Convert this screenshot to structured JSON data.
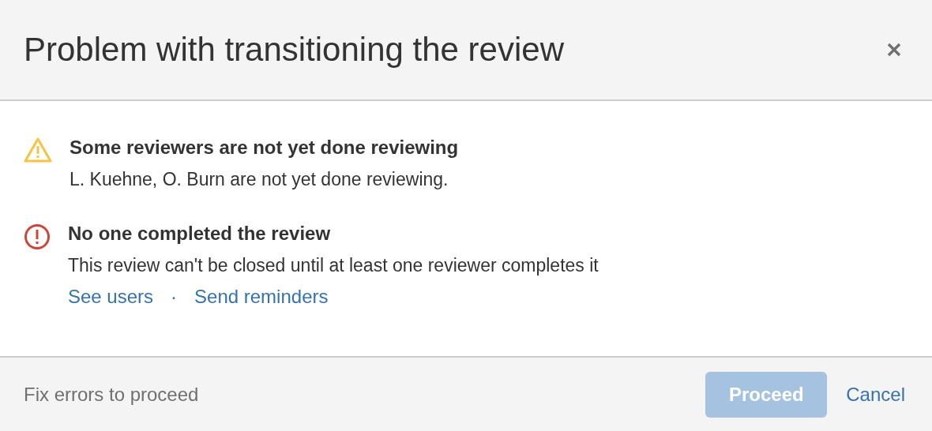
{
  "dialog": {
    "title": "Problem with transitioning the review"
  },
  "messages": [
    {
      "kind": "warning",
      "title": "Some reviewers are not yet done reviewing",
      "text": "L. Kuehne, O. Burn are not yet done reviewing."
    },
    {
      "kind": "error",
      "title": "No one completed the review",
      "text": "This review can't be closed until at least one reviewer completes it",
      "links": [
        "See users",
        "Send reminders"
      ],
      "separator": "·"
    }
  ],
  "footer": {
    "hint": "Fix errors to proceed",
    "proceed": {
      "label": "Proceed",
      "disabled": true
    },
    "cancel": {
      "label": "Cancel"
    }
  }
}
